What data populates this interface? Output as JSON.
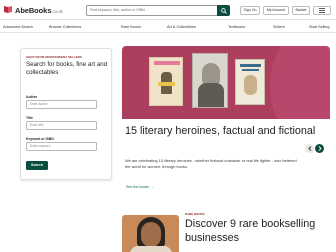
{
  "header": {
    "logo_text": "AbeBooks",
    "logo_tld": ".co.uk",
    "search_placeholder": "Find keyword, title, author or ISBN",
    "signin_label": "Sign On",
    "account_label": "My Account",
    "basket_label": "Basket",
    "accent_color": "#0b4d3f",
    "logo_color": "#c0293a"
  },
  "nav": {
    "items": [
      "Advanced Search",
      "Browse Collections",
      "Rare Books",
      "Art & Collectibles",
      "Textbooks",
      "Sellers",
      "Start Selling"
    ]
  },
  "search_panel": {
    "tag": "SHOP FROM INDEPENDENT SELLERS",
    "title": "Search for books, fine art and collectables",
    "author_label": "Author",
    "author_placeholder": "Enter Author",
    "title_label": "Title",
    "title_placeholder": "Enter title",
    "keyword_label": "Keyword or ISBN",
    "keyword_placeholder": "Enter keyword",
    "search_button": "Search"
  },
  "hero": {
    "title": "15 literary heroines, factual and fictional",
    "description": "We are celebrating 15 literary heroines - whether fictional character or real life fighter - who bettered the world for women, through books.",
    "link_label": "See the books",
    "link_arrow": "→",
    "image_color": "#ac3e5e"
  },
  "card2": {
    "tag": "RARE BOOKS",
    "title": "Discover 9 rare bookselling businesses"
  }
}
